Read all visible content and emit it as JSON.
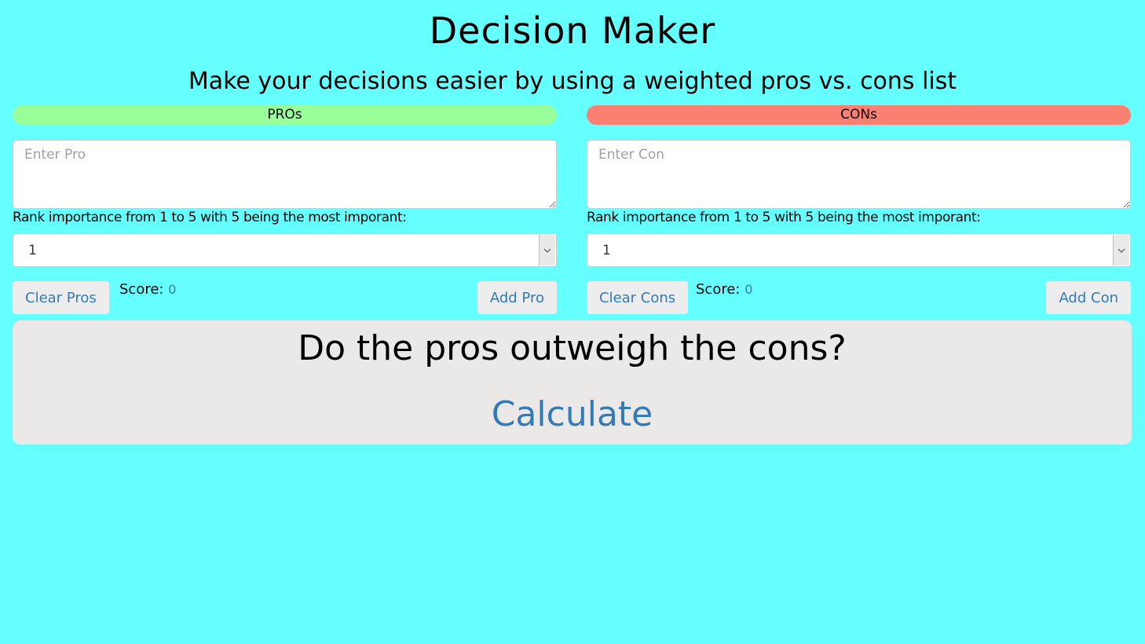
{
  "header": {
    "title": "Decision Maker",
    "subtitle": "Make your decisions easier by using a weighted pros vs. cons list"
  },
  "pros": {
    "heading": "PROs",
    "placeholder": "Enter Pro",
    "rank_label": "Rank importance from 1 to 5 with 5 being the most imporant:",
    "rank_selected": "1",
    "clear_label": "Clear Pros",
    "score_label": "Score:",
    "score_value": "0",
    "add_label": "Add Pro",
    "color": "#99ff99"
  },
  "cons": {
    "heading": "CONs",
    "placeholder": "Enter Con",
    "rank_label": "Rank importance from 1 to 5 with 5 being the most imporant:",
    "rank_selected": "1",
    "clear_label": "Clear Cons",
    "score_label": "Score:",
    "score_value": "0",
    "add_label": "Add Con",
    "color": "#fa8072"
  },
  "result": {
    "question": "Do the pros outweigh the cons?",
    "calculate_label": "Calculate"
  },
  "theme": {
    "background": "#66ffff",
    "link_color": "#337ab7",
    "panel_color": "#ebe8e8"
  }
}
